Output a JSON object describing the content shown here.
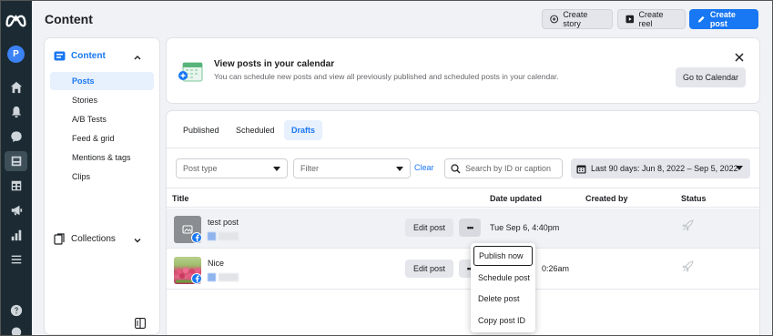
{
  "header": {
    "title": "Content",
    "create_story": "Create story",
    "create_reel": "Create reel",
    "create_post": "Create post"
  },
  "account": {
    "avatar_letter": "P"
  },
  "rail": {
    "icons": [
      "home-icon",
      "bell-icon",
      "chat-icon",
      "content-icon",
      "calendar-grid-icon",
      "megaphone-icon",
      "insights-icon",
      "menu-icon",
      "help-icon"
    ]
  },
  "nav": {
    "section_label": "Content",
    "items": [
      {
        "label": "Posts"
      },
      {
        "label": "Stories"
      },
      {
        "label": "A/B Tests"
      },
      {
        "label": "Feed & grid"
      },
      {
        "label": "Mentions & tags"
      },
      {
        "label": "Clips"
      }
    ],
    "collections_label": "Collections"
  },
  "banner": {
    "title": "View posts in your calendar",
    "description": "You can schedule new posts and view all previously published and scheduled posts in your calendar.",
    "button": "Go to Calendar"
  },
  "tabs": [
    {
      "label": "Published"
    },
    {
      "label": "Scheduled"
    },
    {
      "label": "Drafts"
    }
  ],
  "filters": {
    "post_type": "Post type",
    "filter": "Filter",
    "clear": "Clear",
    "search_placeholder": "Search by ID or caption",
    "date_range": "Last 90 days: Jun 8, 2022 – Sep 5, 2022"
  },
  "table": {
    "columns": {
      "title": "Title",
      "date_updated": "Date updated",
      "created_by": "Created by",
      "status": "Status"
    },
    "rows": [
      {
        "title": "test post",
        "edit": "Edit post",
        "more": "•••",
        "date": "Tue Sep 6, 4:40pm"
      },
      {
        "title": "Nice",
        "edit": "Edit post",
        "more": "•••",
        "date": "0:26am"
      }
    ]
  },
  "menu": {
    "items": [
      {
        "label": "Publish now"
      },
      {
        "label": "Schedule post"
      },
      {
        "label": "Delete post"
      },
      {
        "label": "Copy post ID"
      }
    ]
  },
  "colors": {
    "accent": "#1877f2",
    "rail": "#1c2b33",
    "page_bg": "#f0f2f5"
  }
}
